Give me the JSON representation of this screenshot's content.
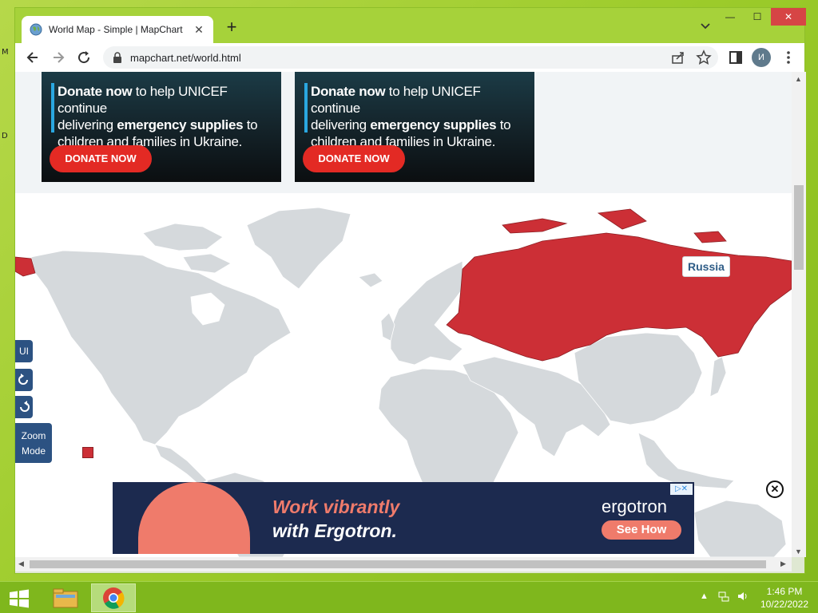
{
  "browser": {
    "tab_title": "World Map - Simple | MapChart",
    "url": "mapchart.net/world.html",
    "profile_initial": "И",
    "new_tab_glyph": "+",
    "tab_close_glyph": "✕",
    "window_controls": {
      "minimize": "—",
      "maximize": "☐",
      "close": "✕"
    }
  },
  "ads_top": [
    {
      "line1_bold": "Donate now",
      "line1_rest": " to help UNICEF continue",
      "line2_pre": "delivering ",
      "line2_bold": "emergency supplies",
      "line2_rest": " to",
      "line3": "children and families in Ukraine.",
      "button": "DONATE NOW"
    },
    {
      "line1_bold": "Donate now",
      "line1_rest": " to help UNICEF continue",
      "line2_pre": "delivering ",
      "line2_bold": "emergency supplies",
      "line2_rest": " to",
      "line3": "children and families in Ukraine.",
      "button": "DONATE NOW"
    }
  ],
  "map": {
    "tooltip": "Russia",
    "highlighted_country": "Russia",
    "highlight_color": "#cc2f36",
    "land_color": "#d5d9dc",
    "controls": {
      "ui": "UI",
      "undo_icon": "undo-icon",
      "redo_icon": "redo-icon",
      "zoom_mode_line1": "Zoom",
      "zoom_mode_line2": "Mode"
    }
  },
  "banner_ad": {
    "headline_line1": "Work vibrantly",
    "headline_line2": "with Ergotron.",
    "brand": "ergotron",
    "cta": "See How",
    "adchoices": "▷✕"
  },
  "desktop_fragments": [
    "M",
    "D"
  ],
  "taskbar": {
    "time": "1:46 PM",
    "date": "10/22/2022"
  }
}
